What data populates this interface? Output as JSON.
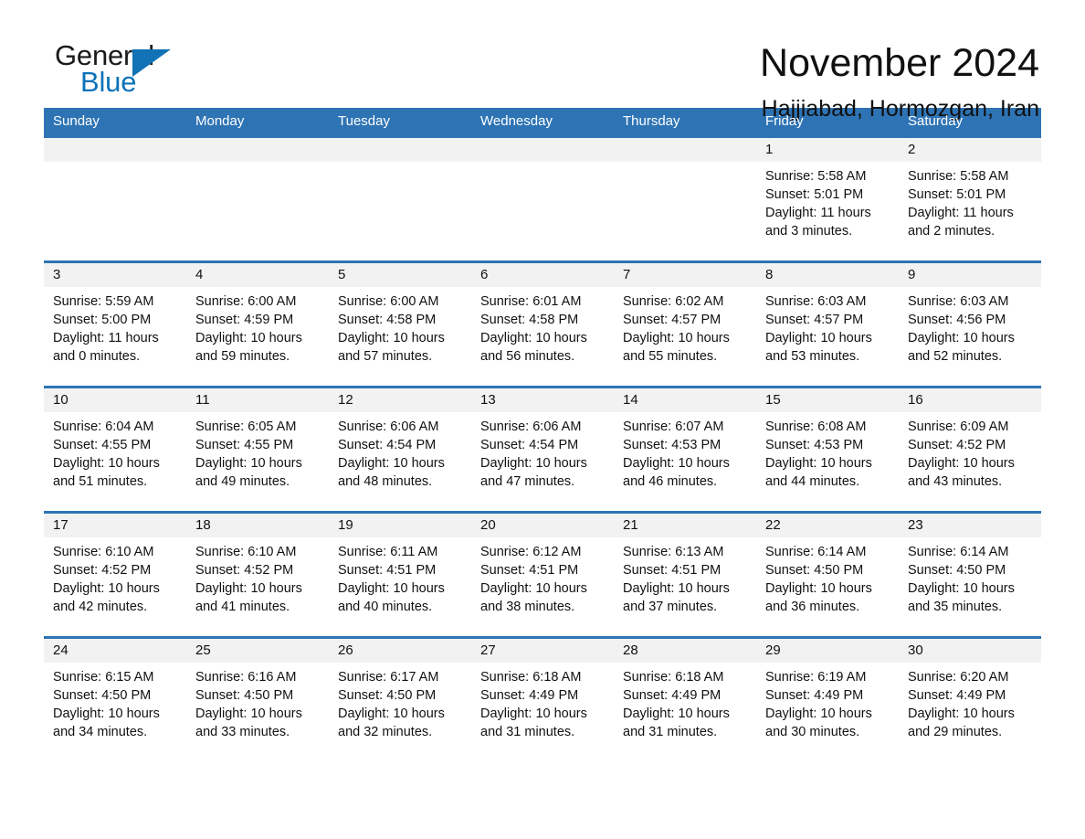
{
  "brand": {
    "name_part1": "General",
    "name_part2": "Blue",
    "accent_color": "#1272b6",
    "triangle_icon": "blue-triangle-icon"
  },
  "header": {
    "title": "November 2024",
    "location": "Hajjiabad, Hormozgan, Iran"
  },
  "calendar": {
    "header_bg": "#2e74b5",
    "datebar_bg": "#f2f2f2",
    "weekdays": [
      "Sunday",
      "Monday",
      "Tuesday",
      "Wednesday",
      "Thursday",
      "Friday",
      "Saturday"
    ],
    "weeks": [
      {
        "days": [
          {
            "num": "",
            "sunrise": "",
            "sunset": "",
            "daylight1": "",
            "daylight2": ""
          },
          {
            "num": "",
            "sunrise": "",
            "sunset": "",
            "daylight1": "",
            "daylight2": ""
          },
          {
            "num": "",
            "sunrise": "",
            "sunset": "",
            "daylight1": "",
            "daylight2": ""
          },
          {
            "num": "",
            "sunrise": "",
            "sunset": "",
            "daylight1": "",
            "daylight2": ""
          },
          {
            "num": "",
            "sunrise": "",
            "sunset": "",
            "daylight1": "",
            "daylight2": ""
          },
          {
            "num": "1",
            "sunrise": "Sunrise: 5:58 AM",
            "sunset": "Sunset: 5:01 PM",
            "daylight1": "Daylight: 11 hours",
            "daylight2": "and 3 minutes."
          },
          {
            "num": "2",
            "sunrise": "Sunrise: 5:58 AM",
            "sunset": "Sunset: 5:01 PM",
            "daylight1": "Daylight: 11 hours",
            "daylight2": "and 2 minutes."
          }
        ]
      },
      {
        "days": [
          {
            "num": "3",
            "sunrise": "Sunrise: 5:59 AM",
            "sunset": "Sunset: 5:00 PM",
            "daylight1": "Daylight: 11 hours",
            "daylight2": "and 0 minutes."
          },
          {
            "num": "4",
            "sunrise": "Sunrise: 6:00 AM",
            "sunset": "Sunset: 4:59 PM",
            "daylight1": "Daylight: 10 hours",
            "daylight2": "and 59 minutes."
          },
          {
            "num": "5",
            "sunrise": "Sunrise: 6:00 AM",
            "sunset": "Sunset: 4:58 PM",
            "daylight1": "Daylight: 10 hours",
            "daylight2": "and 57 minutes."
          },
          {
            "num": "6",
            "sunrise": "Sunrise: 6:01 AM",
            "sunset": "Sunset: 4:58 PM",
            "daylight1": "Daylight: 10 hours",
            "daylight2": "and 56 minutes."
          },
          {
            "num": "7",
            "sunrise": "Sunrise: 6:02 AM",
            "sunset": "Sunset: 4:57 PM",
            "daylight1": "Daylight: 10 hours",
            "daylight2": "and 55 minutes."
          },
          {
            "num": "8",
            "sunrise": "Sunrise: 6:03 AM",
            "sunset": "Sunset: 4:57 PM",
            "daylight1": "Daylight: 10 hours",
            "daylight2": "and 53 minutes."
          },
          {
            "num": "9",
            "sunrise": "Sunrise: 6:03 AM",
            "sunset": "Sunset: 4:56 PM",
            "daylight1": "Daylight: 10 hours",
            "daylight2": "and 52 minutes."
          }
        ]
      },
      {
        "days": [
          {
            "num": "10",
            "sunrise": "Sunrise: 6:04 AM",
            "sunset": "Sunset: 4:55 PM",
            "daylight1": "Daylight: 10 hours",
            "daylight2": "and 51 minutes."
          },
          {
            "num": "11",
            "sunrise": "Sunrise: 6:05 AM",
            "sunset": "Sunset: 4:55 PM",
            "daylight1": "Daylight: 10 hours",
            "daylight2": "and 49 minutes."
          },
          {
            "num": "12",
            "sunrise": "Sunrise: 6:06 AM",
            "sunset": "Sunset: 4:54 PM",
            "daylight1": "Daylight: 10 hours",
            "daylight2": "and 48 minutes."
          },
          {
            "num": "13",
            "sunrise": "Sunrise: 6:06 AM",
            "sunset": "Sunset: 4:54 PM",
            "daylight1": "Daylight: 10 hours",
            "daylight2": "and 47 minutes."
          },
          {
            "num": "14",
            "sunrise": "Sunrise: 6:07 AM",
            "sunset": "Sunset: 4:53 PM",
            "daylight1": "Daylight: 10 hours",
            "daylight2": "and 46 minutes."
          },
          {
            "num": "15",
            "sunrise": "Sunrise: 6:08 AM",
            "sunset": "Sunset: 4:53 PM",
            "daylight1": "Daylight: 10 hours",
            "daylight2": "and 44 minutes."
          },
          {
            "num": "16",
            "sunrise": "Sunrise: 6:09 AM",
            "sunset": "Sunset: 4:52 PM",
            "daylight1": "Daylight: 10 hours",
            "daylight2": "and 43 minutes."
          }
        ]
      },
      {
        "days": [
          {
            "num": "17",
            "sunrise": "Sunrise: 6:10 AM",
            "sunset": "Sunset: 4:52 PM",
            "daylight1": "Daylight: 10 hours",
            "daylight2": "and 42 minutes."
          },
          {
            "num": "18",
            "sunrise": "Sunrise: 6:10 AM",
            "sunset": "Sunset: 4:52 PM",
            "daylight1": "Daylight: 10 hours",
            "daylight2": "and 41 minutes."
          },
          {
            "num": "19",
            "sunrise": "Sunrise: 6:11 AM",
            "sunset": "Sunset: 4:51 PM",
            "daylight1": "Daylight: 10 hours",
            "daylight2": "and 40 minutes."
          },
          {
            "num": "20",
            "sunrise": "Sunrise: 6:12 AM",
            "sunset": "Sunset: 4:51 PM",
            "daylight1": "Daylight: 10 hours",
            "daylight2": "and 38 minutes."
          },
          {
            "num": "21",
            "sunrise": "Sunrise: 6:13 AM",
            "sunset": "Sunset: 4:51 PM",
            "daylight1": "Daylight: 10 hours",
            "daylight2": "and 37 minutes."
          },
          {
            "num": "22",
            "sunrise": "Sunrise: 6:14 AM",
            "sunset": "Sunset: 4:50 PM",
            "daylight1": "Daylight: 10 hours",
            "daylight2": "and 36 minutes."
          },
          {
            "num": "23",
            "sunrise": "Sunrise: 6:14 AM",
            "sunset": "Sunset: 4:50 PM",
            "daylight1": "Daylight: 10 hours",
            "daylight2": "and 35 minutes."
          }
        ]
      },
      {
        "days": [
          {
            "num": "24",
            "sunrise": "Sunrise: 6:15 AM",
            "sunset": "Sunset: 4:50 PM",
            "daylight1": "Daylight: 10 hours",
            "daylight2": "and 34 minutes."
          },
          {
            "num": "25",
            "sunrise": "Sunrise: 6:16 AM",
            "sunset": "Sunset: 4:50 PM",
            "daylight1": "Daylight: 10 hours",
            "daylight2": "and 33 minutes."
          },
          {
            "num": "26",
            "sunrise": "Sunrise: 6:17 AM",
            "sunset": "Sunset: 4:50 PM",
            "daylight1": "Daylight: 10 hours",
            "daylight2": "and 32 minutes."
          },
          {
            "num": "27",
            "sunrise": "Sunrise: 6:18 AM",
            "sunset": "Sunset: 4:49 PM",
            "daylight1": "Daylight: 10 hours",
            "daylight2": "and 31 minutes."
          },
          {
            "num": "28",
            "sunrise": "Sunrise: 6:18 AM",
            "sunset": "Sunset: 4:49 PM",
            "daylight1": "Daylight: 10 hours",
            "daylight2": "and 31 minutes."
          },
          {
            "num": "29",
            "sunrise": "Sunrise: 6:19 AM",
            "sunset": "Sunset: 4:49 PM",
            "daylight1": "Daylight: 10 hours",
            "daylight2": "and 30 minutes."
          },
          {
            "num": "30",
            "sunrise": "Sunrise: 6:20 AM",
            "sunset": "Sunset: 4:49 PM",
            "daylight1": "Daylight: 10 hours",
            "daylight2": "and 29 minutes."
          }
        ]
      }
    ]
  }
}
